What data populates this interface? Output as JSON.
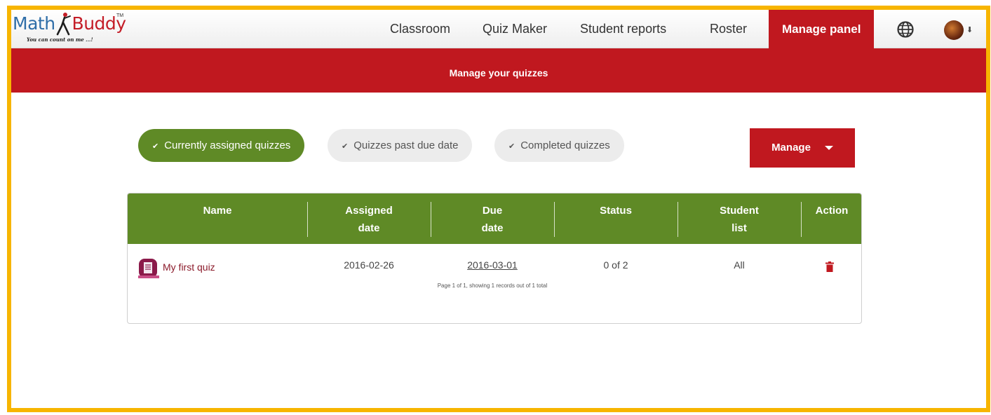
{
  "brand": {
    "logo_math": "Math",
    "logo_buddy": "Buddy",
    "logo_tm": "TM",
    "tagline": "You can count on me ...!"
  },
  "nav": {
    "items": [
      {
        "label": "Classroom"
      },
      {
        "label": "Quiz Maker"
      },
      {
        "label": "Student reports"
      },
      {
        "label": "Roster"
      },
      {
        "label": "Manage panel",
        "active": true
      }
    ],
    "globe_icon": "globe-icon",
    "avatar_icon": "avatar",
    "avatar_caret": "⬇"
  },
  "banner": {
    "title": "Manage your quizzes"
  },
  "filters": [
    {
      "label": "Currently assigned quizzes",
      "active": true,
      "icon": "check-icon"
    },
    {
      "label": "Quizzes past due date",
      "active": false,
      "icon": "check-icon"
    },
    {
      "label": "Completed quizzes",
      "active": false,
      "icon": "check-icon"
    }
  ],
  "manage_button": {
    "label": "Manage",
    "icon": "caret-down-icon"
  },
  "table": {
    "columns": [
      {
        "line1": "Name",
        "line2": ""
      },
      {
        "line1": "Assigned",
        "line2": "date"
      },
      {
        "line1": "Due",
        "line2": "date"
      },
      {
        "line1": "Status",
        "line2": ""
      },
      {
        "line1": "Student",
        "line2": "list"
      },
      {
        "line1": "Action",
        "line2": ""
      }
    ],
    "rows": [
      {
        "name": "My first quiz",
        "assigned_date": "2016-02-26",
        "due_date": "2016-03-01",
        "status": "0 of 2",
        "student_list": "All",
        "action_icon": "trash-icon"
      }
    ],
    "pagination": "Page 1 of 1, showing 1 records out of 1 total"
  },
  "colors": {
    "brand_red": "#c0181f",
    "green": "#5f8a26",
    "frame_yellow": "#f7b500"
  }
}
